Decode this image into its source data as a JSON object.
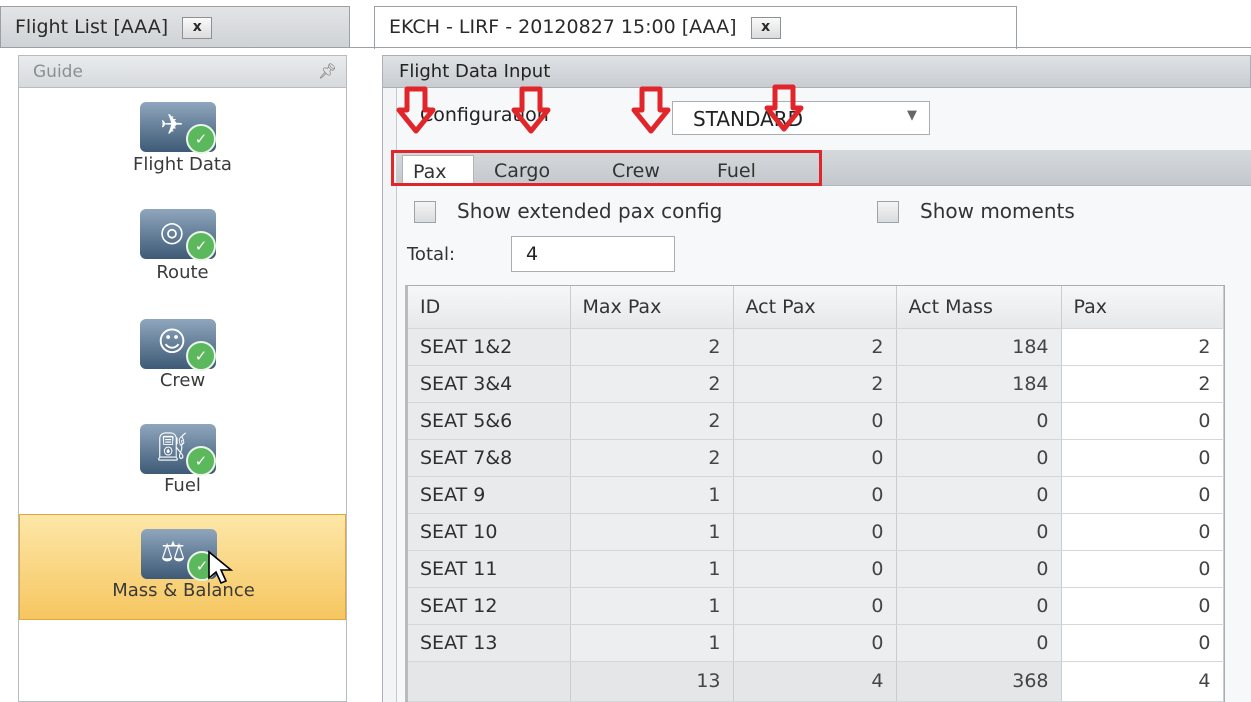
{
  "doc_tabs": [
    {
      "label": "Flight List [AAA]",
      "close": "x"
    },
    {
      "label": "EKCH - LIRF - 20120827 15:00 [AAA]",
      "close": "x"
    }
  ],
  "guide": {
    "title": "Guide",
    "pin_icon": "pin-icon",
    "items": [
      {
        "label": "Flight Data",
        "icon": "airplane-icon"
      },
      {
        "label": "Route",
        "icon": "globe-icon"
      },
      {
        "label": "Crew",
        "icon": "crew-icon"
      },
      {
        "label": "Fuel",
        "icon": "fuel-nozzle-icon"
      },
      {
        "label": "Mass & Balance",
        "icon": "scale-icon"
      }
    ]
  },
  "panel": {
    "title": "Flight Data Input",
    "config_label": "Configuration",
    "config_value": "STANDARD",
    "tabs": [
      "Pax",
      "Cargo",
      "Crew",
      "Fuel"
    ],
    "active_tab": "Pax",
    "show_extended": "Show extended pax config",
    "show_moments": "Show moments",
    "total_label": "Total:",
    "total_value": "4"
  },
  "grid": {
    "columns": [
      "ID",
      "Max Pax",
      "Act Pax",
      "Act Mass",
      "Pax"
    ],
    "rows": [
      [
        "SEAT 1&2",
        "2",
        "2",
        "184",
        "2"
      ],
      [
        "SEAT 3&4",
        "2",
        "2",
        "184",
        "2"
      ],
      [
        "SEAT 5&6",
        "2",
        "0",
        "0",
        "0"
      ],
      [
        "SEAT 7&8",
        "2",
        "0",
        "0",
        "0"
      ],
      [
        "SEAT 9",
        "1",
        "0",
        "0",
        "0"
      ],
      [
        "SEAT 10",
        "1",
        "0",
        "0",
        "0"
      ],
      [
        "SEAT 11",
        "1",
        "0",
        "0",
        "0"
      ],
      [
        "SEAT 12",
        "1",
        "0",
        "0",
        "0"
      ],
      [
        "SEAT 13",
        "1",
        "0",
        "0",
        "0"
      ]
    ],
    "totals": [
      "",
      "13",
      "4",
      "368",
      "4"
    ]
  },
  "colors": {
    "highlight": "#e0262b",
    "selected_nav": "#f6c660",
    "check_badge": "#5cb85c"
  }
}
